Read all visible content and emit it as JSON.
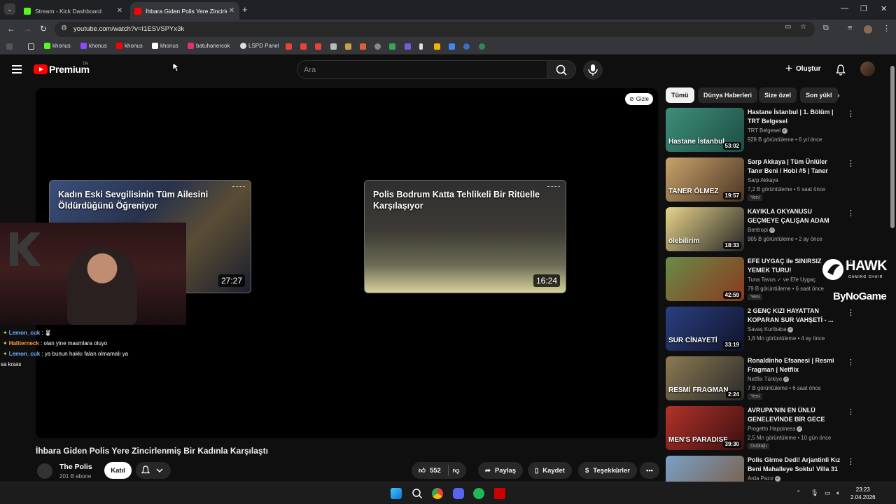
{
  "browser": {
    "tabs": [
      {
        "title": "Stream - Kick Dashboard",
        "color": "#53fc18"
      },
      {
        "title": "İhbara Giden Polis Yere Zincirlen",
        "color": "#ff0000"
      }
    ],
    "url": "youtube.com/watch?v=I1ESVSPYx3k",
    "bookmarks": [
      {
        "label": "khonus",
        "color": "#53fc18"
      },
      {
        "label": "khonus",
        "color": "#9146ff"
      },
      {
        "label": "khonus",
        "color": "#ff0000"
      },
      {
        "label": "khonus",
        "color": "#ffffff"
      },
      {
        "label": "batuhanercok",
        "color": "#e1306c"
      },
      {
        "label": "LSPD Panel",
        "color": "#dddddd"
      }
    ]
  },
  "header": {
    "brand": "Premium",
    "region": "TR",
    "search_placeholder": "Ara",
    "create_label": "Oluştur"
  },
  "player": {
    "hide_label": "Gizle",
    "endcards": [
      {
        "title": "Kadın Eski Sevgilisinin Tüm Ailesini Öldürdüğünü Öğreniyor",
        "duration": "27:27"
      },
      {
        "title": "Polis Bodrum Katta Tehlikeli Bir Ritüelle Karşılaşıyor",
        "duration": "16:24"
      }
    ]
  },
  "chat": [
    {
      "user": "Lemon_cuk",
      "text": " : 🐰",
      "color": "#6fb6ff"
    },
    {
      "user": "Haliterneck",
      "text": " : olan yine masmlara oluyo",
      "color": "#ff9a3c"
    },
    {
      "user": "Lemon_cuk",
      "text": " : ya bunun hakkı falan olmamalı ya",
      "color": "#6fb6ff"
    },
    {
      "user": "",
      "text": "sa kısas",
      "color": "#ffffff"
    }
  ],
  "video": {
    "title": "İhbara Giden Polis Yere Zincirlenmiş Bir Kadınla Karşılaştı",
    "channel": "The Polis",
    "subscribers": "201 B abone",
    "join_label": "Katıl",
    "likes": "552",
    "share_label": "Paylaş",
    "save_label": "Kaydet",
    "thanks_label": "Teşekkürler"
  },
  "chips": [
    "Tümü",
    "Dünya Haberleri",
    "Size özel",
    "Son yükl"
  ],
  "recommendations": [
    {
      "title": "Hastane İstanbul | 1. Bölüm | TRT Belgesel",
      "channel": "TRT Belgesel",
      "verified": true,
      "meta": "928 B görüntüleme • 6 yıl önce",
      "duration": "53:02",
      "badge": "",
      "thumb_text": "Hastane İstanbul",
      "colors": [
        "#3f8f7a",
        "#1d4d44"
      ]
    },
    {
      "title": "Sarp Akkaya | Tüm Ünlüler Tanır Beni / Hobi #5 | Taner Ölmez il...",
      "channel": "Sarp Akkaya",
      "verified": false,
      "meta": "7,2 B görüntüleme • 5 saat önce",
      "duration": "19:57",
      "badge": "Yeni",
      "thumb_text": "TANER ÖLMEZ",
      "colors": [
        "#c9a36a",
        "#4a3524"
      ]
    },
    {
      "title": "KAYIKLA OKYANUSU GEÇMEYE ÇALIŞAN ADAM",
      "channel": "Bentropi",
      "verified": true,
      "meta": "905 B görüntüleme • 2 ay önce",
      "duration": "18:33",
      "badge": "",
      "thumb_text": "ölebilirim",
      "colors": [
        "#e8d48a",
        "#262626"
      ]
    },
    {
      "title": "EFE UYGAÇ ile SINIRSIZ YEMEK TURU!",
      "channel": "Tuna Tavus ✓ ve Efe Uygaç",
      "verified": false,
      "meta": "79 B görüntüleme • 6 saat önce",
      "duration": "42:59",
      "badge": "Yeni",
      "thumb_text": "",
      "colors": [
        "#6a8a48",
        "#8a3a1c"
      ]
    },
    {
      "title": "2 GENÇ KIZI HAYATTAN KOPARAN SUR VAHŞETİ - ...",
      "channel": "Savaş Kurtbaba",
      "verified": true,
      "meta": "1,8 Mn görüntüleme • 4 ay önce",
      "duration": "33:19",
      "badge": "",
      "thumb_text": "SUR CİNAYETİ",
      "colors": [
        "#2b3f80",
        "#10142c"
      ]
    },
    {
      "title": "Ronaldinho Efsanesi | Resmi Fragman | Netflix",
      "channel": "Netflix Türkiye",
      "verified": true,
      "meta": "7 B görüntüleme • 6 saat önce",
      "duration": "2:24",
      "badge": "Yeni",
      "thumb_text": "RESMİ FRAGMAN",
      "colors": [
        "#8c7a52",
        "#2a2a2a"
      ]
    },
    {
      "title": "AVRUPA'NIN EN ÜNLÜ GENELEVİNDE BİR GECE",
      "channel": "Progetto Happiness",
      "verified": true,
      "meta": "2,5 Mn görüntüleme • 10 gün önce",
      "duration": "39:30",
      "badge": "Dublajlı",
      "thumb_text": "MEN'S PARADISE",
      "colors": [
        "#b3322a",
        "#3a1010"
      ]
    },
    {
      "title": "Polis Girme Dedi! Arjantinli Kız Beni Mahalleye Soktu! Villa 31",
      "channel": "Arda Pazır",
      "verified": true,
      "meta": "",
      "duration": "",
      "badge": "",
      "thumb_text": "Villa 31",
      "colors": [
        "#7aa0c8",
        "#7a5a40"
      ]
    }
  ],
  "overlay": {
    "brand_line1": "HAWK",
    "brand_line2": "GAMING CHAIR",
    "brand_line3": "ByNoGame"
  },
  "clock": {
    "time": "23:23",
    "date": "2.04.2026"
  }
}
